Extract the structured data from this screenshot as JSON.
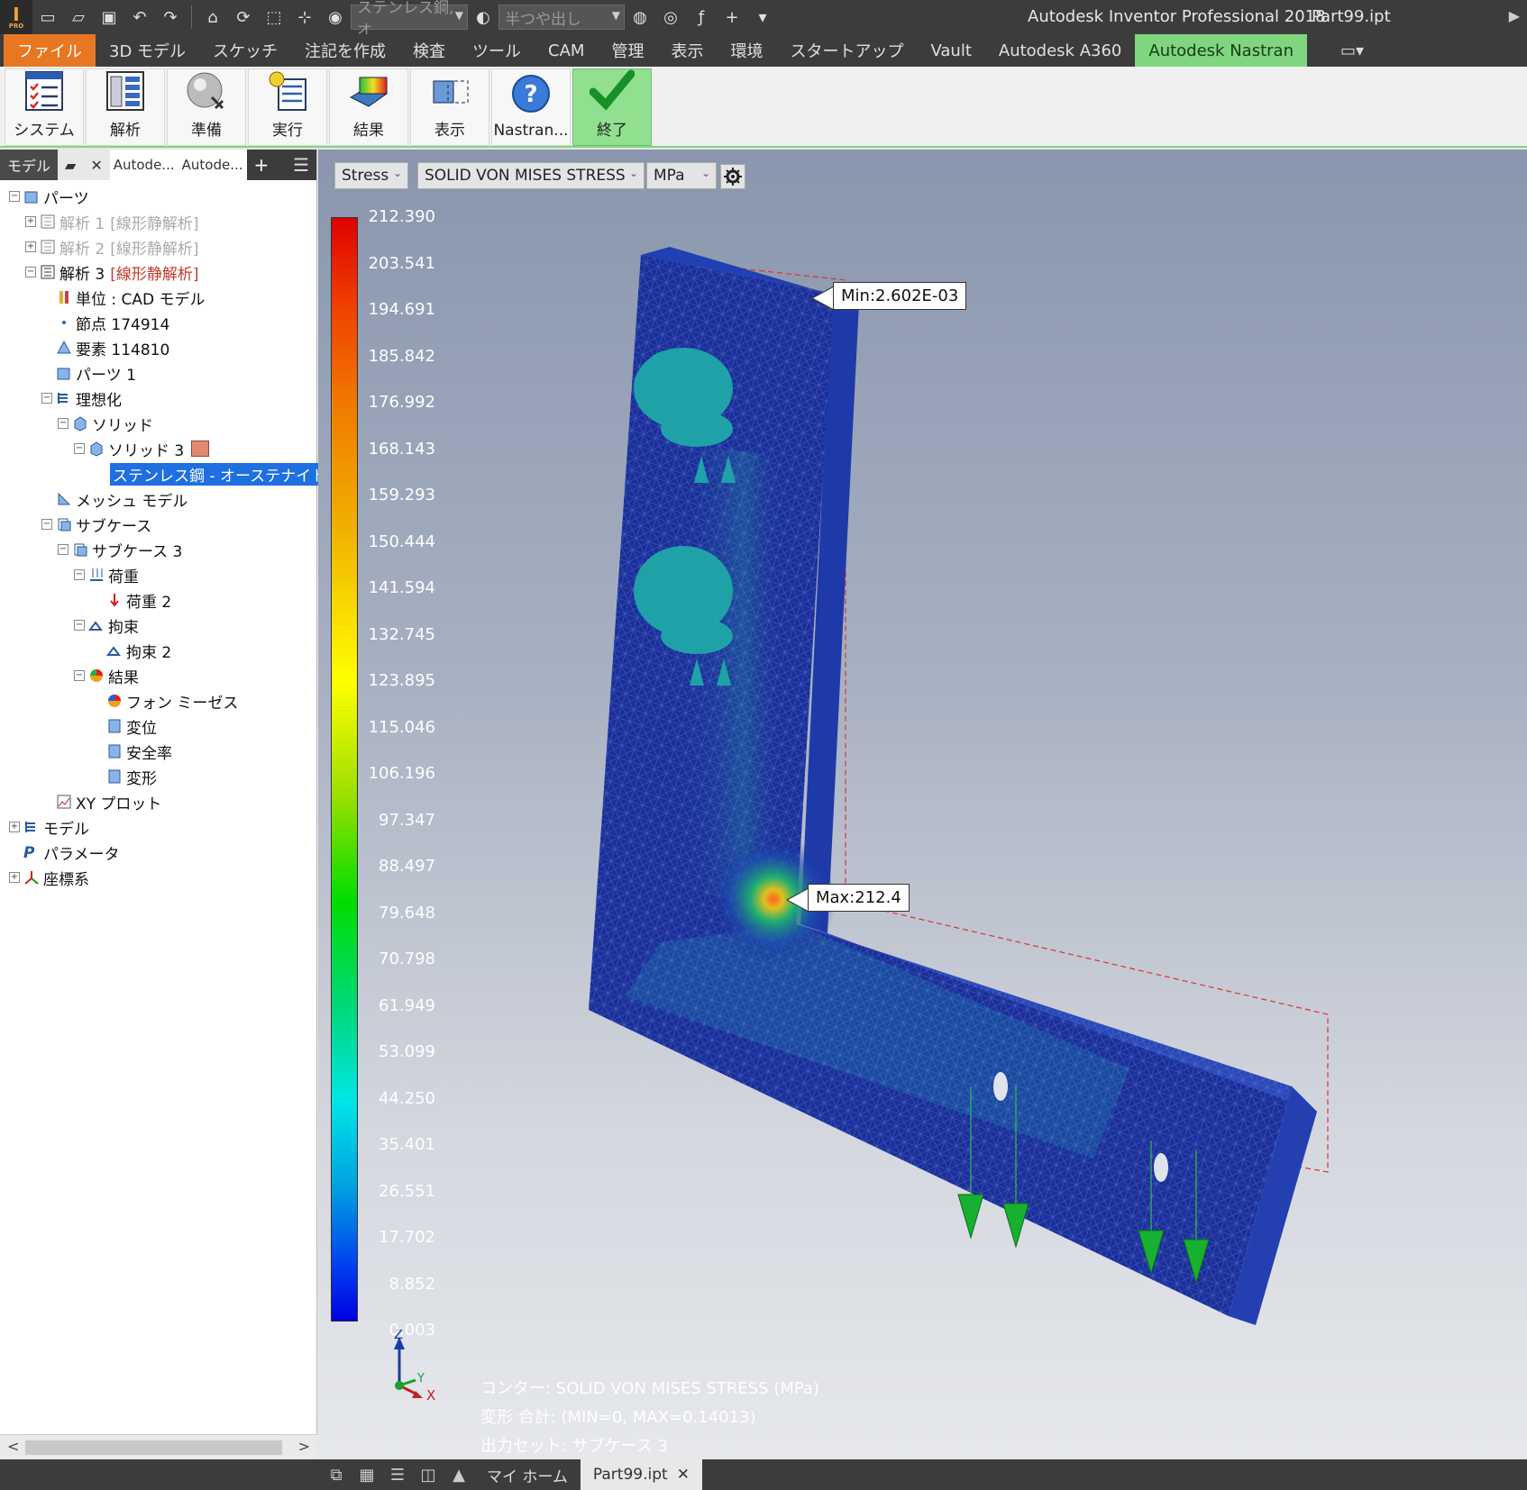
{
  "titlebar": {
    "app_title": "Autodesk Inventor Professional 2018",
    "file_title": "Part99.ipt",
    "material_combo": "ステンレス鋼, オ",
    "appearance_combo": "半つや出し"
  },
  "menu": {
    "tabs": [
      "ファイル",
      "3D モデル",
      "スケッチ",
      "注記を作成",
      "検査",
      "ツール",
      "CAM",
      "管理",
      "表示",
      "環境",
      "スタートアップ",
      "Vault",
      "Autodesk A360",
      "Autodesk Nastran"
    ]
  },
  "ribbon": {
    "buttons": [
      "システム",
      "解析",
      "準備",
      "実行",
      "結果",
      "表示",
      "Nastran...",
      "終了"
    ]
  },
  "browser": {
    "tabs": [
      "モデル",
      "Autode...",
      "Autode..."
    ],
    "tree": [
      {
        "label": "パーツ"
      },
      {
        "label": "解析 1",
        "tag": "[線形静解析]"
      },
      {
        "label": "解析 2",
        "tag": "[線形静解析]"
      },
      {
        "label": "解析 3",
        "tag": "[線形静解析]"
      },
      {
        "label": "単位 : CAD モデル"
      },
      {
        "label": "節点 174914"
      },
      {
        "label": "要素 114810"
      },
      {
        "label": "パーツ 1"
      },
      {
        "label": "理想化"
      },
      {
        "label": "ソリッド"
      },
      {
        "label": "ソリッド 3"
      },
      {
        "label": "ステンレス鋼 - オーステナイト系"
      },
      {
        "label": "メッシュ モデル"
      },
      {
        "label": "サブケース"
      },
      {
        "label": "サブケース 3"
      },
      {
        "label": "荷重"
      },
      {
        "label": "荷重 2"
      },
      {
        "label": "拘束"
      },
      {
        "label": "拘束 2"
      },
      {
        "label": "結果"
      },
      {
        "label": "フォン ミーゼス"
      },
      {
        "label": "変位"
      },
      {
        "label": "安全率"
      },
      {
        "label": "変形"
      },
      {
        "label": "XY プロット"
      },
      {
        "label": "モデル"
      },
      {
        "label": "パラメータ"
      },
      {
        "label": "座標系"
      }
    ]
  },
  "viewport": {
    "result_type": "Stress",
    "result_component": "SOLID VON MISES STRESS",
    "units": "MPa",
    "legend_values": [
      "212.390",
      "203.541",
      "194.691",
      "185.842",
      "176.992",
      "168.143",
      "159.293",
      "150.444",
      "141.594",
      "132.745",
      "123.895",
      "115.046",
      "106.196",
      "97.347",
      "88.497",
      "79.648",
      "70.798",
      "61.949",
      "53.099",
      "44.250",
      "35.401",
      "26.551",
      "17.702",
      "8.852",
      "0.003"
    ],
    "min_callout": "Min:2.602E-03",
    "max_callout": "Max:212.4",
    "contour_info": "コンター: SOLID VON MISES STRESS (MPa)",
    "deform_info": "変形 合計: (MIN=0, MAX=0.14013)",
    "output_info": "出力セット: サブケース 3",
    "triad": {
      "z": "Z",
      "y": "Y",
      "x": "X"
    }
  },
  "bottombar": {
    "home_tab": "マイ ホーム",
    "doc_tab": "Part99.ipt"
  },
  "colors": {
    "file_tab": "#e87722",
    "nastran_tab": "#7fd67f",
    "selection": "#1e6fe0",
    "mesh_blue": "#1a2f9a"
  }
}
